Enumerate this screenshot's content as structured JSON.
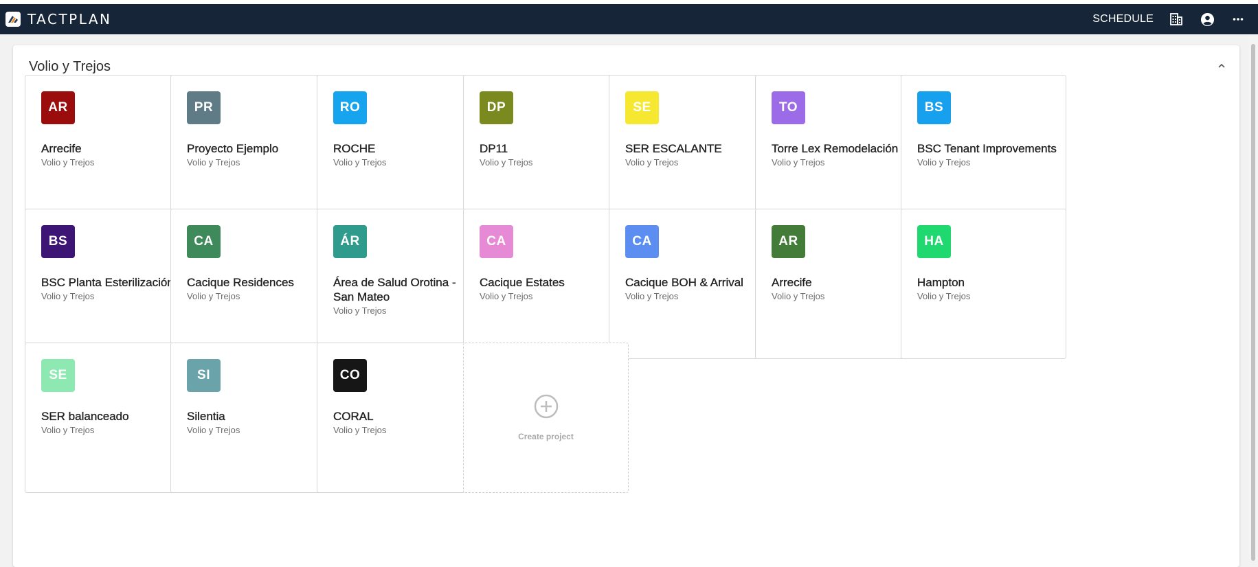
{
  "app": {
    "brand": "TACTPLAN"
  },
  "header": {
    "schedule_label": "SCHEDULE"
  },
  "icons": {
    "logo": "tactplan-logo-icon",
    "building": "building-icon",
    "account": "account-circle-icon",
    "more": "more-horizontal-icon",
    "collapse": "chevron-up-icon",
    "create": "plus-circle-icon"
  },
  "colors": {
    "topbar": "#162638",
    "page_bg": "#f2f2f2"
  },
  "section": {
    "title": "Volio y Trejos"
  },
  "projects": [
    {
      "initials": "AR",
      "name": "Arrecife",
      "org": "Volio y Trejos",
      "color": "#9b0d0d"
    },
    {
      "initials": "PR",
      "name": "Proyecto Ejemplo",
      "org": "Volio y Trejos",
      "color": "#5f7b86"
    },
    {
      "initials": "RO",
      "name": "ROCHE",
      "org": "Volio y Trejos",
      "color": "#16a4ee"
    },
    {
      "initials": "DP",
      "name": "DP11",
      "org": "Volio y Trejos",
      "color": "#7a8a1e"
    },
    {
      "initials": "SE",
      "name": "SER ESCALANTE",
      "org": "Volio y Trejos",
      "color": "#f6e830"
    },
    {
      "initials": "TO",
      "name": "Torre Lex Remodelación",
      "org": "Volio y Trejos",
      "color": "#9b6be8"
    },
    {
      "initials": "BS",
      "name": "BSC Tenant Improvements",
      "org": "Volio y Trejos",
      "color": "#16a0ee"
    },
    {
      "initials": "BS",
      "name": "BSC Planta Esterilización",
      "org": "Volio y Trejos",
      "color": "#3d1575"
    },
    {
      "initials": "CA",
      "name": "Cacique Residences",
      "org": "Volio y Trejos",
      "color": "#3f8a5a"
    },
    {
      "initials": "ÁR",
      "name": "Área de Salud Orotina - San Mateo",
      "org": "Volio y Trejos",
      "color": "#2e9b8c"
    },
    {
      "initials": "CA",
      "name": "Cacique Estates",
      "org": "Volio y Trejos",
      "color": "#e78ad6"
    },
    {
      "initials": "CA",
      "name": "Cacique BOH & Arrival",
      "org": "Volio y Trejos",
      "color": "#5b8ef0"
    },
    {
      "initials": "AR",
      "name": "Arrecife",
      "org": "Volio y Trejos",
      "color": "#437c38"
    },
    {
      "initials": "HA",
      "name": "Hampton",
      "org": "Volio y Trejos",
      "color": "#20d870"
    },
    {
      "initials": "SE",
      "name": "SER balanceado",
      "org": "Volio y Trejos",
      "color": "#8de9b1"
    },
    {
      "initials": "SI",
      "name": "Silentia",
      "org": "Volio y Trejos",
      "color": "#6aa3aa"
    },
    {
      "initials": "CO",
      "name": "CORAL",
      "org": "Volio y Trejos",
      "color": "#161616"
    }
  ],
  "create": {
    "label": "Create project"
  }
}
